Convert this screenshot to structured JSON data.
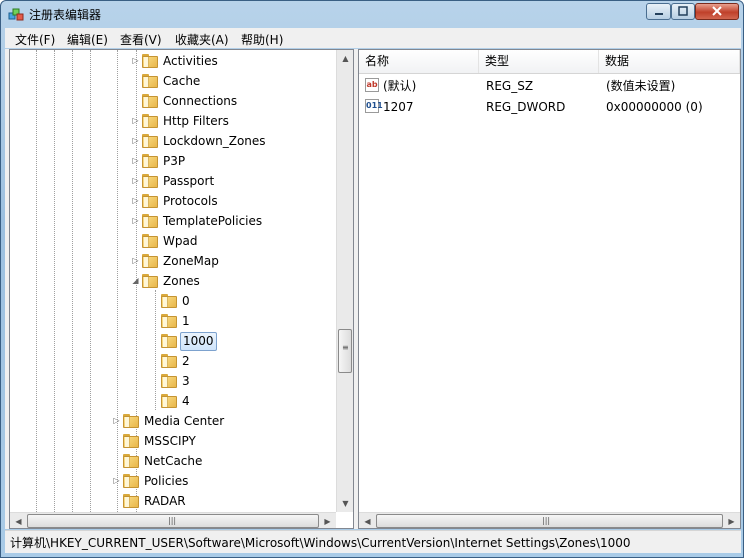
{
  "window": {
    "title": "注册表编辑器"
  },
  "menu": [
    "文件(F)",
    "编辑(E)",
    "查看(V)",
    "收藏夹(A)",
    "帮助(H)"
  ],
  "tree": [
    {
      "label": "Activities",
      "expander": "▷"
    },
    {
      "label": "Cache",
      "expander": ""
    },
    {
      "label": "Connections",
      "expander": ""
    },
    {
      "label": "Http Filters",
      "expander": "▷"
    },
    {
      "label": "Lockdown_Zones",
      "expander": "▷"
    },
    {
      "label": "P3P",
      "expander": "▷"
    },
    {
      "label": "Passport",
      "expander": "▷"
    },
    {
      "label": "Protocols",
      "expander": "▷"
    },
    {
      "label": "TemplatePolicies",
      "expander": "▷"
    },
    {
      "label": "Wpad",
      "expander": ""
    },
    {
      "label": "ZoneMap",
      "expander": "▷"
    },
    {
      "label": "Zones",
      "expander": "◢"
    },
    {
      "label": "0",
      "expander": ""
    },
    {
      "label": "1",
      "expander": ""
    },
    {
      "label": "1000",
      "expander": ""
    },
    {
      "label": "2",
      "expander": ""
    },
    {
      "label": "3",
      "expander": ""
    },
    {
      "label": "4",
      "expander": ""
    },
    {
      "label": "Media Center",
      "expander": "▷"
    },
    {
      "label": "MSSCIPY",
      "expander": ""
    },
    {
      "label": "NetCache",
      "expander": ""
    },
    {
      "label": "Policies",
      "expander": "▷"
    },
    {
      "label": "RADAR",
      "expander": ""
    }
  ],
  "columns": [
    "名称",
    "类型",
    "数据"
  ],
  "values": [
    {
      "icon": "ab",
      "name": "(默认)",
      "type": "REG_SZ",
      "data": "(数值未设置)"
    },
    {
      "icon": "011",
      "name": "1207",
      "type": "REG_DWORD",
      "data": "0x00000000 (0)"
    }
  ],
  "statusbar": {
    "path": "计算机\\HKEY_CURRENT_USER\\Software\\Microsoft\\Windows\\CurrentVersion\\Internet Settings\\Zones\\1000"
  }
}
